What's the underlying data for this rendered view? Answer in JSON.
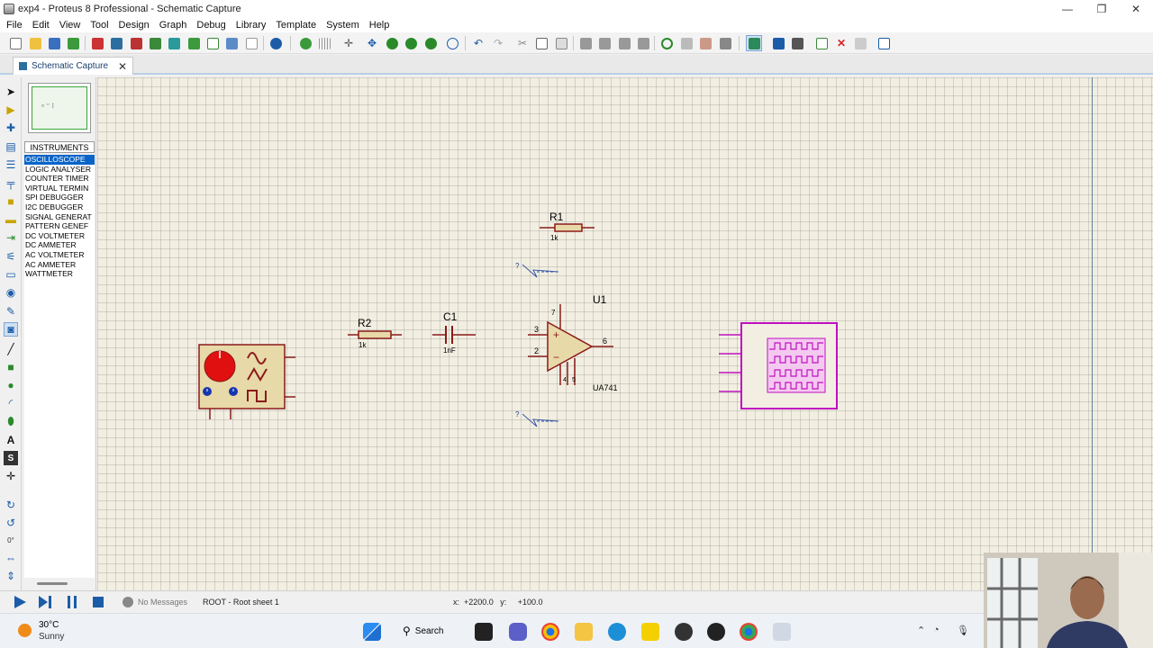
{
  "window": {
    "title": "exp4 - Proteus 8 Professional - Schematic Capture",
    "controls": {
      "minimize": "—",
      "maximize": "❐",
      "close": "✕"
    }
  },
  "menu": [
    "File",
    "Edit",
    "View",
    "Tool",
    "Design",
    "Graph",
    "Debug",
    "Library",
    "Template",
    "System",
    "Help"
  ],
  "tab": {
    "label": "Schematic Capture",
    "close": "✕"
  },
  "panel": {
    "header": "INSTRUMENTS",
    "items": [
      "OSCILLOSCOPE",
      "LOGIC ANALYSER",
      "COUNTER TIMER",
      "VIRTUAL TERMIN",
      "SPI DEBUGGER",
      "I2C DEBUGGER",
      "SIGNAL GENERAT",
      "PATTERN GENEF",
      "DC VOLTMETER",
      "DC AMMETER",
      "AC VOLTMETER",
      "AC AMMETER",
      "WATTMETER"
    ],
    "selected_index": 0
  },
  "left_tools": {
    "rotation_value": "0°"
  },
  "schematic": {
    "r1": {
      "ref": "R1",
      "value": "1k"
    },
    "r2": {
      "ref": "R2",
      "value": "1k"
    },
    "c1": {
      "ref": "C1",
      "value": "1nF"
    },
    "u1": {
      "ref": "U1",
      "part": "UA741",
      "pins": {
        "inv": "2",
        "noninv": "3",
        "out": "6",
        "vcc": "7",
        "vee": "4",
        "off": "5"
      },
      "plus": "+",
      "minus": "−"
    },
    "ground_marker": "?"
  },
  "status": {
    "messages": "No Messages",
    "sheet": "ROOT - Root sheet 1",
    "coords": "x:  +2200.0   y:     +100.0"
  },
  "taskbar": {
    "temperature": "30°C",
    "condition": "Sunny",
    "search": "Search"
  }
}
